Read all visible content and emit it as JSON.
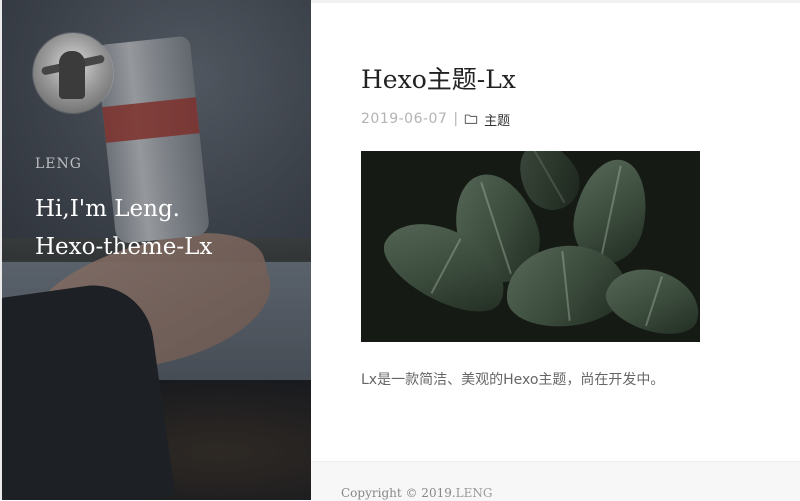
{
  "hero": {
    "name": "LENG",
    "headline_line1": "Hi,I'm Leng.",
    "headline_line2": "Hexo-theme-Lx"
  },
  "post": {
    "title": "Hexo主题-Lx",
    "date": "2019-06-07",
    "separator": "|",
    "category": "主题",
    "excerpt": "Lx是一款简洁、美观的Hexo主题，尚在开发中。"
  },
  "footer": {
    "copyright_prefix": "Copyright © 2019.",
    "copyright_link": "LENG"
  },
  "icons": {
    "category": "folder-icon"
  },
  "colors": {
    "title": "#222222",
    "date": "#b3b3b3",
    "excerpt": "#666666",
    "footer_bg": "#f7f7f7"
  }
}
